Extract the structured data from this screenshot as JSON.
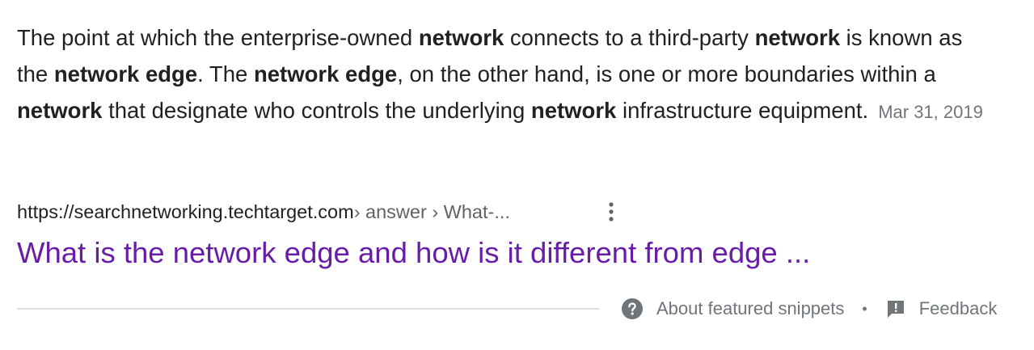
{
  "snippet": {
    "segments": [
      {
        "t": "The point at which the enterprise-owned ",
        "b": false
      },
      {
        "t": "network",
        "b": true
      },
      {
        "t": " connects to a third-party ",
        "b": false
      },
      {
        "t": "network",
        "b": true
      },
      {
        "t": " is known as the ",
        "b": false
      },
      {
        "t": "network edge",
        "b": true
      },
      {
        "t": ". The ",
        "b": false
      },
      {
        "t": "network edge",
        "b": true
      },
      {
        "t": ", on the other hand, is one or more boundaries within a ",
        "b": false
      },
      {
        "t": "network",
        "b": true
      },
      {
        "t": " that designate who controls the underlying ",
        "b": false
      },
      {
        "t": "network",
        "b": true
      },
      {
        "t": " infrastructure equipment.",
        "b": false
      }
    ],
    "date": "Mar 31, 2019"
  },
  "result": {
    "cite_host": "https://searchnetworking.techtarget.com",
    "cite_path": " › answer › What-...",
    "title": "What is the network edge and how is it different from edge ..."
  },
  "footer": {
    "about_label": "About featured snippets",
    "separator": "•",
    "feedback_label": "Feedback"
  },
  "colors": {
    "link_visited": "#681da8",
    "text": "#202124",
    "muted": "#70757a"
  }
}
